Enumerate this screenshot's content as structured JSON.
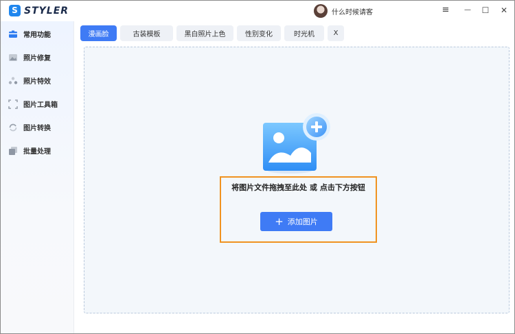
{
  "app": {
    "logo_letter": "S",
    "name": "STYLER"
  },
  "user": {
    "name": "什么时候请客"
  },
  "window_controls": {
    "menu": "≡",
    "minimize": "—",
    "maximize": "☐",
    "close": "✕"
  },
  "sidebar": {
    "items": [
      {
        "label": "常用功能",
        "icon": "common-functions-icon",
        "active": true
      },
      {
        "label": "照片修复",
        "icon": "photo-repair-icon"
      },
      {
        "label": "照片特效",
        "icon": "photo-effects-icon"
      },
      {
        "label": "图片工具箱",
        "icon": "toolbox-icon"
      },
      {
        "label": "图片转换",
        "icon": "convert-icon"
      },
      {
        "label": "批量处理",
        "icon": "batch-icon"
      }
    ]
  },
  "tabs": {
    "items": [
      {
        "label": "漫画脸",
        "active": true
      },
      {
        "label": "古装模板"
      },
      {
        "label": "黑白照片上色"
      },
      {
        "label": "性别变化"
      },
      {
        "label": "时光机"
      }
    ],
    "close_label": "X"
  },
  "upload": {
    "prompt": "将图片文件拖拽至此处 或 点击下方按钮",
    "button_icon": "+",
    "button_label": "添加图片"
  },
  "colors": {
    "accent": "#3f7bf5",
    "highlight_border": "#f0921f",
    "dropzone_bg": "#f3f7fb"
  }
}
